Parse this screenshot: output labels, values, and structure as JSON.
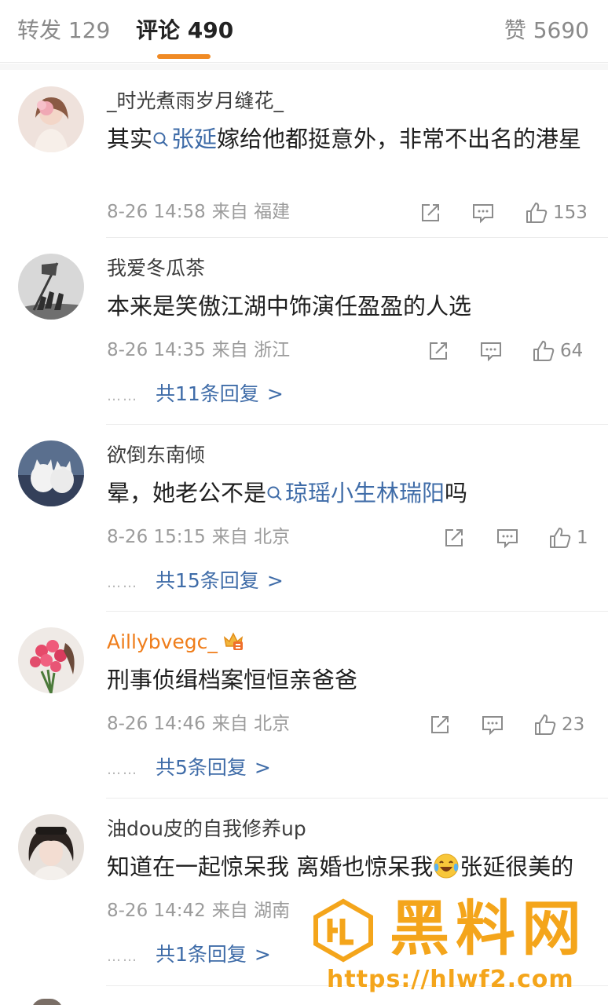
{
  "tabs": {
    "repost": "转发 129",
    "comments": "评论 490",
    "likes": "赞 5690"
  },
  "colors": {
    "accent": "#f08a24",
    "link": "#3f6ca8",
    "meta": "#9b9b9b",
    "vip_name": "#ef7d1a",
    "watermark": "#f4a51b"
  },
  "comments": [
    {
      "username": "_时光煮雨岁月缝花_",
      "avatar": "woman-with-flowers",
      "text_before": "其实",
      "topic": "张延",
      "text_after": "嫁给他都挺意外，非常不出名的港星",
      "date": "8-26 14:58",
      "source": "来自 福建",
      "likes": "153"
    },
    {
      "username": "我爱冬瓜茶",
      "avatar": "flag-raising-silhouette",
      "text": "本来是笑傲江湖中饰演任盈盈的人选",
      "date": "8-26 14:35",
      "source": "来自 浙江",
      "likes": "64",
      "replies": "共11条回复"
    },
    {
      "username": "欲倒东南倾",
      "avatar": "white-cats",
      "text_before": "晕，她老公不是",
      "topic": "琼瑶小生林瑞阳",
      "text_after": "吗",
      "date": "8-26 15:15",
      "source": "来自 北京",
      "likes": "1",
      "replies": "共15条回复"
    },
    {
      "username": "Aillybvegc_",
      "avatar": "pink-roses",
      "text": "刑事侦缉档案恒恒亲爸爸",
      "date": "8-26 14:46",
      "source": "来自 北京",
      "likes": "23",
      "replies": "共5条回复"
    },
    {
      "username": "油dou皮的自我修养up",
      "avatar": "woman-portrait",
      "text_before": "知道在一起惊呆我 离婚也惊呆我",
      "emoji": "laughing-crying-emoji",
      "text_after": "张延很美的",
      "date": "8-26 14:42",
      "source": "来自 湖南",
      "replies": "共1条回复"
    }
  ],
  "ui": {
    "reply_dots": "……",
    "chevron": ">"
  },
  "watermark": {
    "text": "黑料网",
    "url": "https://hlwf2.com"
  }
}
